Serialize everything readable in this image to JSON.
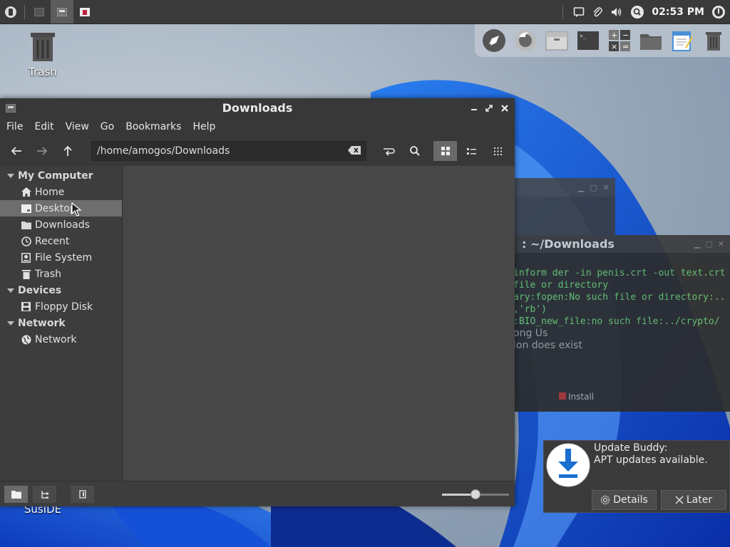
{
  "top_panel": {
    "clock": "02:53 PM"
  },
  "desktop": {
    "trash_label": "Trash",
    "susIde_label": "SusIDE"
  },
  "terminal": {
    "title": ": ~/Downloads",
    "lines": [
      "inform der -in penis.crt -out text.crt",
      "file or directory",
      "ary:fopen:No such file or directory:..",
      ",'rb')",
      ":BIO_new_file:no such file:../crypto/"
    ],
    "grey_lines": [
      "ong Us",
      "ion does exist"
    ],
    "install_label": "Install"
  },
  "file_manager": {
    "title": "Downloads",
    "menu": [
      "File",
      "Edit",
      "View",
      "Go",
      "Bookmarks",
      "Help"
    ],
    "path": "/home/amogos/Downloads",
    "sidebar": {
      "my_computer": "My Computer",
      "computer_items": [
        "Home",
        "Desktop",
        "Downloads",
        "Recent",
        "File System",
        "Trash"
      ],
      "devices": "Devices",
      "device_items": [
        "Floppy Disk"
      ],
      "network": "Network",
      "network_items": [
        "Network"
      ],
      "selected": "Desktop"
    },
    "zoom_level": 0.5
  },
  "notification": {
    "title": "Update Buddy:",
    "message": "APT updates available.",
    "details_label": "Details",
    "later_label": "Later"
  },
  "colors": {
    "accent_blue": "#1a6fd1",
    "terminal_green": "#67c26b"
  }
}
